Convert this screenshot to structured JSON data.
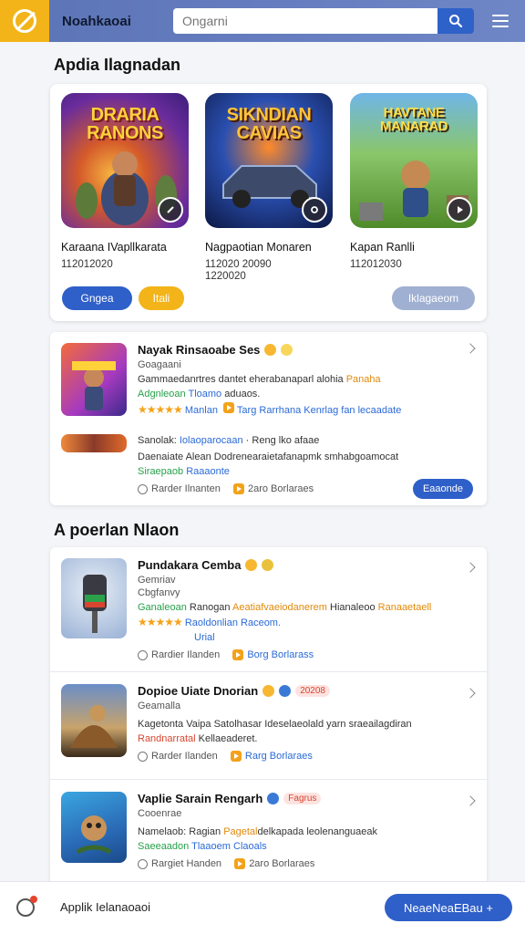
{
  "header": {
    "title": "Noahkaoai",
    "search_placeholder": "Ongarni",
    "brand_color": "#f2b418",
    "bar_color": "#5b74b6"
  },
  "featured_section": {
    "title": "Apdia Ilagnadan",
    "items": [
      {
        "art_title": "DRARIA RANONS",
        "name": "Karaana IVapllkarata",
        "meta": "112012020"
      },
      {
        "art_title": "SIKNDIAN CAVIAS",
        "name": "Nagpaotian Monaren",
        "meta": "112020 20090\n1220020"
      },
      {
        "art_title": "HAVTANE MANARAD",
        "name": "Kapan Ranlli",
        "meta": "112012030"
      }
    ],
    "pill_blue": "Gngea",
    "pill_yellow": "Itali",
    "pill_grey": "Iklagaeom"
  },
  "top_list": {
    "items": [
      {
        "title": "Nayak Rinsaoabe Ses",
        "sub": "Goagaani",
        "desc_a": "Gammaedanrtres dantet eherabanaparl alohia",
        "desc_b": "Panaha",
        "line2_a": "Adgnleoan",
        "line2_b": "Tloamo",
        "line2_c": "aduaos.",
        "stars": "★★★★★",
        "rating_label": "Manlan",
        "extra": "Targ Rarrhana Kenrlag fan lecaadate"
      },
      {
        "sub_a": "Sanolak:",
        "sub_b": "Iolaoparocaan",
        "sub_c": "· Reng lko afaae",
        "desc": "Daenaiate Alean Dodrenearaietafanapmk smhabgoamocat",
        "line2_a": "Siraepaob",
        "line2_b": "Raaaonte",
        "foot_a": "Rarder Ilnanten",
        "foot_b": "2aro Borlaraes",
        "button": "Eaaonde"
      }
    ]
  },
  "more_section": {
    "title": "A poerlan Nlaon",
    "items": [
      {
        "title": "Pundakara Cemba",
        "sub_a": "Gemriav",
        "sub_b": "Cbgfanvy",
        "line1_a": "Ganaleoan",
        "line1_b": "Ranogan",
        "line1_c": "Aeatiafvaeiodanerem",
        "line1_d": "Hianaleoo",
        "line1_e": "Ranaaetaell",
        "stars": "★★★★★",
        "line2": "Raoldonlian Raceom.",
        "line3": "Urial",
        "foot_a": "Rardier Ilanden",
        "foot_b": "Borg Borlarass"
      },
      {
        "title": "Dopioe Uiate Dnorian",
        "tag": "20208",
        "sub": "Geamalla",
        "line1": "Kagetonta Vaipa Satolhasar Ideselaeolald yarn sraeailagdiran",
        "line2_a": "Randnarratal",
        "line2_b": "Kellaeaderet.",
        "foot_a": "Rarder Ilanden",
        "foot_b": "Rarg Borlaraes"
      },
      {
        "title": "Vaplie Sarain Rengarh",
        "tag": "Fagrus",
        "sub": "Cooenrae",
        "line1_a": "Namelaob: Ragian",
        "line1_b": "Pagetal",
        "line1_c": "delkapada leolenanguaeak",
        "line2_a": "Saeeaadon",
        "line2_b": "Tlaaoem Claoals",
        "foot_a": "Rargiet Handen",
        "foot_b": "2aro Borlaraes"
      }
    ]
  },
  "bottom_bar": {
    "label": "Applik Ielanaoaoi",
    "button": "NeaeNeaEBau +"
  }
}
